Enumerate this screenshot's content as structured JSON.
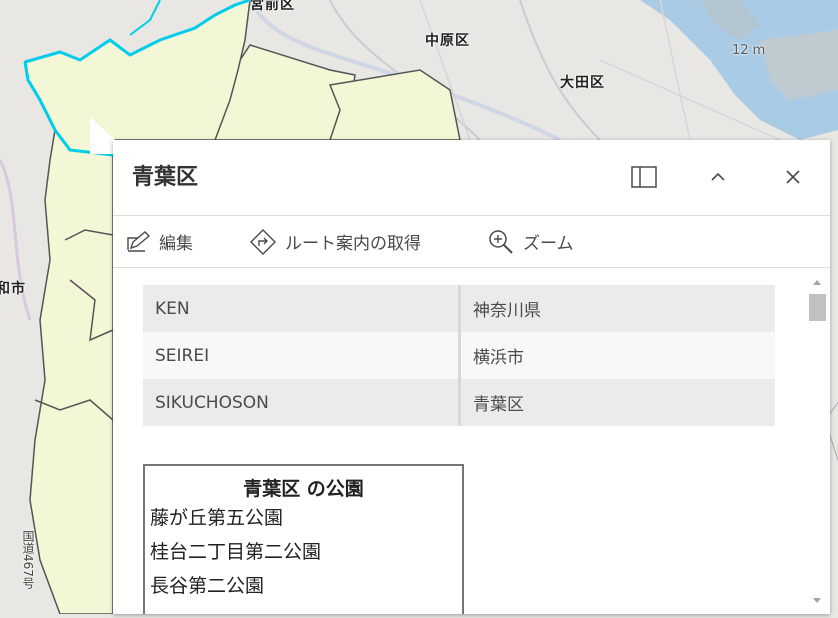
{
  "map": {
    "labels": {
      "miyamae": "宮前区",
      "nakahara": "中原区",
      "ota": "大田区",
      "elevation": "12 m",
      "city_fragment": "和市",
      "road": "国道467号"
    },
    "colors": {
      "land": "#e9e7e3",
      "water": "#a9cbe5",
      "selected_area": "#f4f7d5",
      "highlight": "#00cdeb",
      "boundary": "#555555"
    }
  },
  "popup": {
    "title": "青葉区",
    "header_icons": [
      "dock-icon",
      "collapse-icon",
      "close-icon"
    ],
    "actions": [
      {
        "label": "編集",
        "icon": "edit-icon"
      },
      {
        "label": "ルート案内の取得",
        "icon": "directions-icon"
      },
      {
        "label": "ズーム",
        "icon": "zoom-in-icon"
      }
    ],
    "attributes": [
      {
        "key": "KEN",
        "value": "神奈川県"
      },
      {
        "key": "SEIREI",
        "value": "横浜市"
      },
      {
        "key": "SIKUCHOSON",
        "value": "青葉区"
      }
    ],
    "parks": {
      "title": "青葉区 の公園",
      "items": [
        "藤が丘第五公園",
        "桂台二丁目第二公園",
        "長谷第二公園"
      ]
    }
  }
}
